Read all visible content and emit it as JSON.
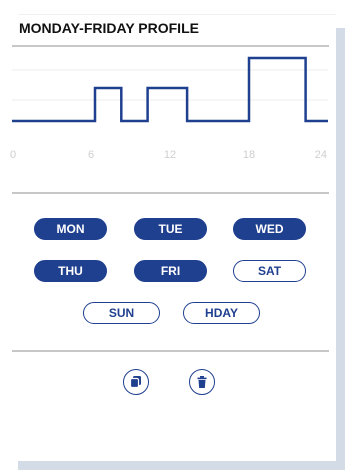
{
  "title": "MONDAY-FRIDAY PROFILE",
  "colors": {
    "accent": "#1f3f8f",
    "tick": "#cfcfcf",
    "rule": "#c7c7c7"
  },
  "chart_data": {
    "type": "line",
    "step": true,
    "x_ticks": [
      "0",
      "6",
      "12",
      "18",
      "24"
    ],
    "xlim": [
      0,
      24
    ],
    "ylim": [
      0,
      3
    ],
    "levels": [
      1,
      2
    ],
    "grid": true,
    "x": [
      0,
      6.3,
      6.3,
      8.3,
      8.3,
      10.3,
      10.3,
      13.3,
      13.3,
      18.0,
      18.0,
      22.3,
      22.3,
      24
    ],
    "y": [
      0.3,
      0.3,
      1.4,
      1.4,
      0.3,
      0.3,
      1.4,
      1.4,
      0.3,
      0.3,
      2.4,
      2.4,
      0.3,
      0.3
    ]
  },
  "days": [
    {
      "label": "MON",
      "selected": true
    },
    {
      "label": "TUE",
      "selected": true
    },
    {
      "label": "WED",
      "selected": true
    },
    {
      "label": "THU",
      "selected": true
    },
    {
      "label": "FRI",
      "selected": true
    },
    {
      "label": "SAT",
      "selected": false
    },
    {
      "label": "SUN",
      "selected": false
    },
    {
      "label": "HDAY",
      "selected": false
    }
  ],
  "actions": [
    {
      "name": "copy-icon"
    },
    {
      "name": "trash-icon"
    }
  ]
}
